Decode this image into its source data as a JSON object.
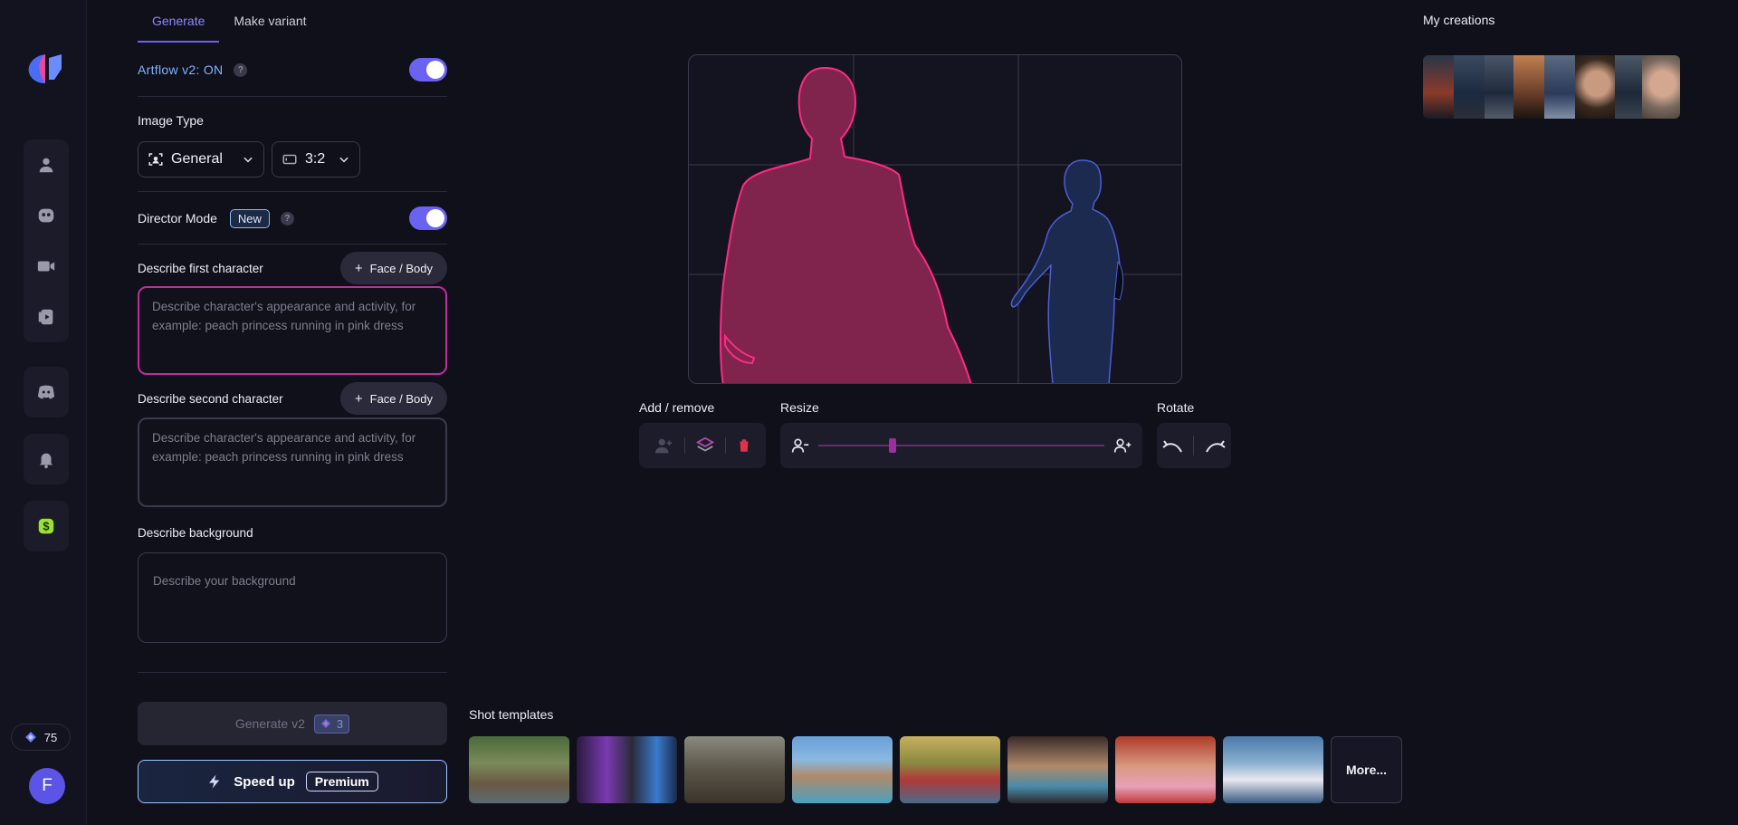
{
  "tabs": [
    "Generate",
    "Make variant"
  ],
  "artflow": {
    "label": "Artflow v2: ON",
    "help": "?",
    "enabled": true
  },
  "image_type": {
    "label": "Image Type",
    "type_value": "General",
    "ratio_value": "3:2"
  },
  "director": {
    "label": "Director Mode",
    "badge": "New",
    "help": "?",
    "enabled": true
  },
  "first_character": {
    "label": "Describe first character",
    "button": "Face / Body",
    "placeholder": "Describe character's appearance and activity, for example: peach princess running in pink dress"
  },
  "second_character": {
    "label": "Describe second character",
    "button": "Face / Body",
    "placeholder": "Describe character's appearance and activity, for example: peach princess running in pink dress"
  },
  "background": {
    "label": "Describe background",
    "placeholder": "Describe your background"
  },
  "generate": {
    "label": "Generate v2",
    "cost": "3"
  },
  "speed_up": {
    "label": "Speed up",
    "badge": "Premium"
  },
  "credits": {
    "value": "75"
  },
  "user": {
    "initial": "F"
  },
  "controls": {
    "add_remove": "Add / remove",
    "resize": "Resize",
    "rotate": "Rotate",
    "resize_level": 0.26
  },
  "my_creations": {
    "title": "My creations"
  },
  "shot_templates": {
    "title": "Shot templates",
    "more": "More..."
  },
  "colors": {
    "accent": "#6a62f0",
    "character1": "#e0327f",
    "character2": "#3d5bb4"
  }
}
